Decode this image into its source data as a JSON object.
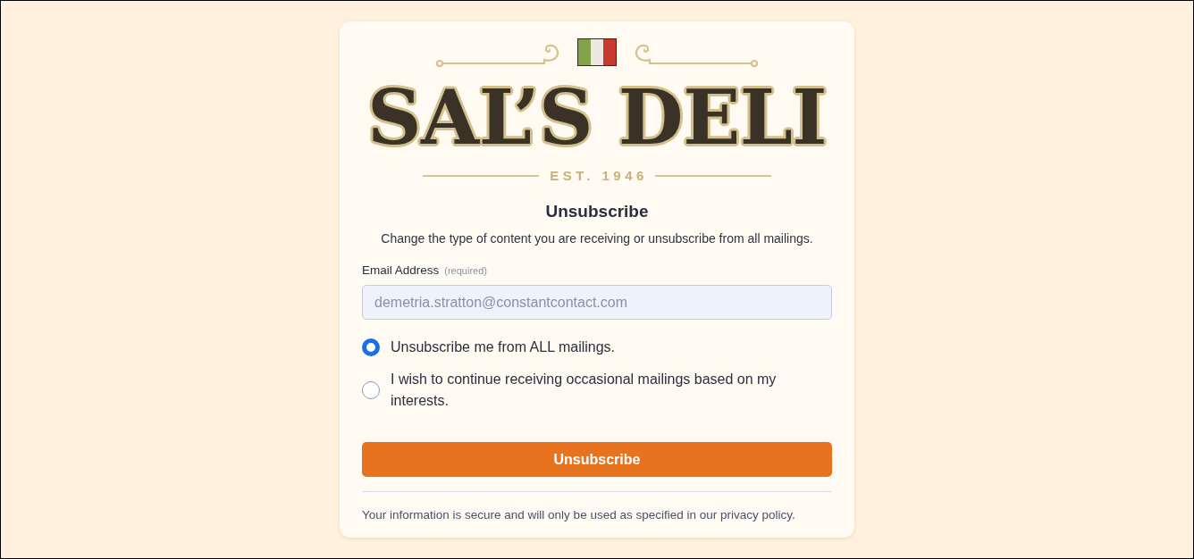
{
  "logo": {
    "name": "SAL’S DELI",
    "tagline": "EST. 1946"
  },
  "form": {
    "title": "Unsubscribe",
    "description": "Change the type of content you are receiving or unsubscribe from all mailings.",
    "email": {
      "label": "Email Address",
      "hint": "(required)",
      "value": "demetria.stratton@constantcontact.com"
    },
    "options": [
      {
        "label": "Unsubscribe me from ALL mailings.",
        "selected": true
      },
      {
        "label": "I wish to continue receiving occasional mailings based on my interests.",
        "selected": false
      }
    ],
    "submit": "Unsubscribe"
  },
  "footer": "Your information is secure and will only be used as specified in our privacy policy."
}
